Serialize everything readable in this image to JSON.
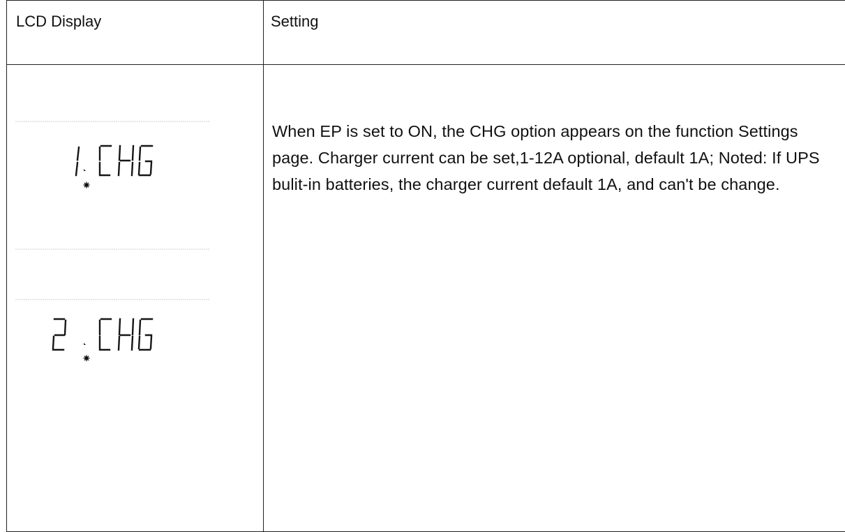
{
  "table": {
    "header": {
      "lcd_display": "LCD Display",
      "setting": "Setting"
    },
    "row": {
      "lcd_screens": [
        {
          "digit": "1",
          "code": "CHG"
        },
        {
          "digit": "2",
          "code": "CHG"
        }
      ],
      "setting_text": "When EP is set to ON, the CHG option appears on the function Settings page. Charger current can be set,1-12A optional, default 1A; Noted: If UPS bulit-in batteries, the charger current default 1A, and can't be change."
    }
  }
}
